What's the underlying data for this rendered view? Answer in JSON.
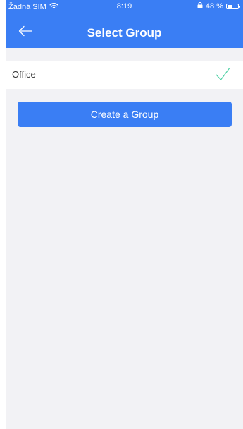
{
  "colors": {
    "header_bg": "#3a7ef4",
    "content_bg": "#f2f2f5",
    "button_bg": "#3a7ef4",
    "check_color": "#4fd1a5"
  },
  "status_bar": {
    "carrier": "Žádná SIM",
    "wifi_icon": "wifi-icon",
    "time": "8:19",
    "orientation_lock_icon": "lock-icon",
    "battery_text": "48 %",
    "battery_level_percent": 48
  },
  "header": {
    "back_icon": "arrow-left-icon",
    "title": "Select Group"
  },
  "groups": [
    {
      "label": "Office",
      "selected": true,
      "check_icon": "checkmark-icon"
    }
  ],
  "actions": {
    "create_group_label": "Create a Group"
  }
}
